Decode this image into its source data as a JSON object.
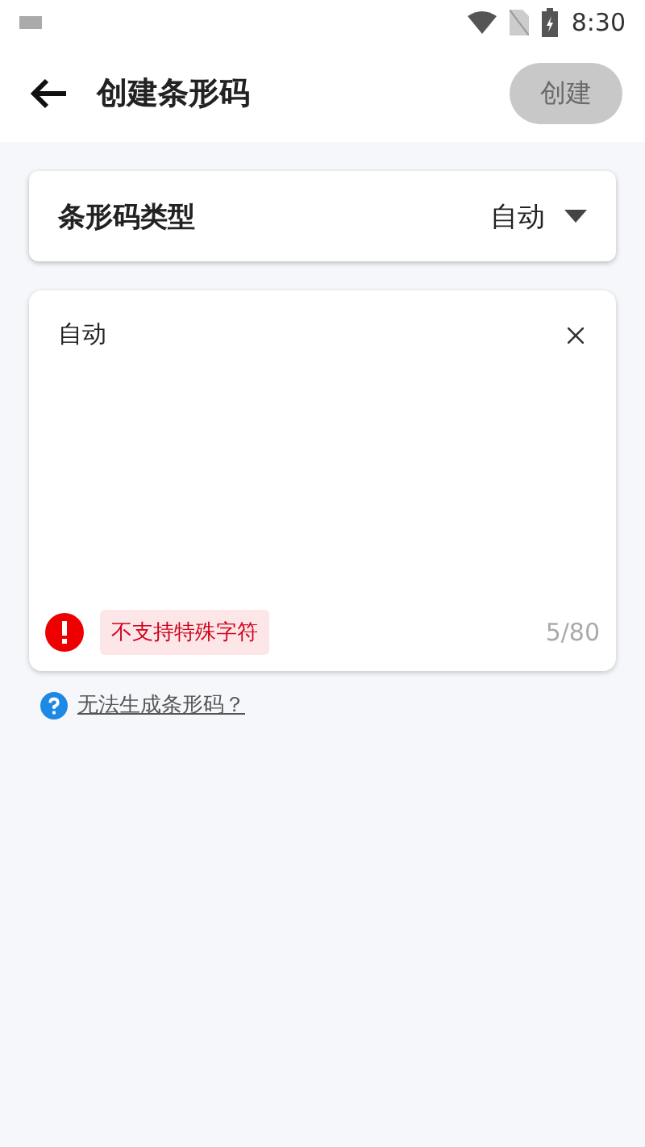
{
  "status_bar": {
    "time": "8:30"
  },
  "toolbar": {
    "title": "创建条形码",
    "create_button": {
      "label": "创建",
      "disabled": true
    }
  },
  "type_selector": {
    "label": "条形码类型",
    "value": "自动"
  },
  "input": {
    "value": "自动",
    "counter": "5/80",
    "error": "不支持特殊字符"
  },
  "help_link": "无法生成条形码？"
}
